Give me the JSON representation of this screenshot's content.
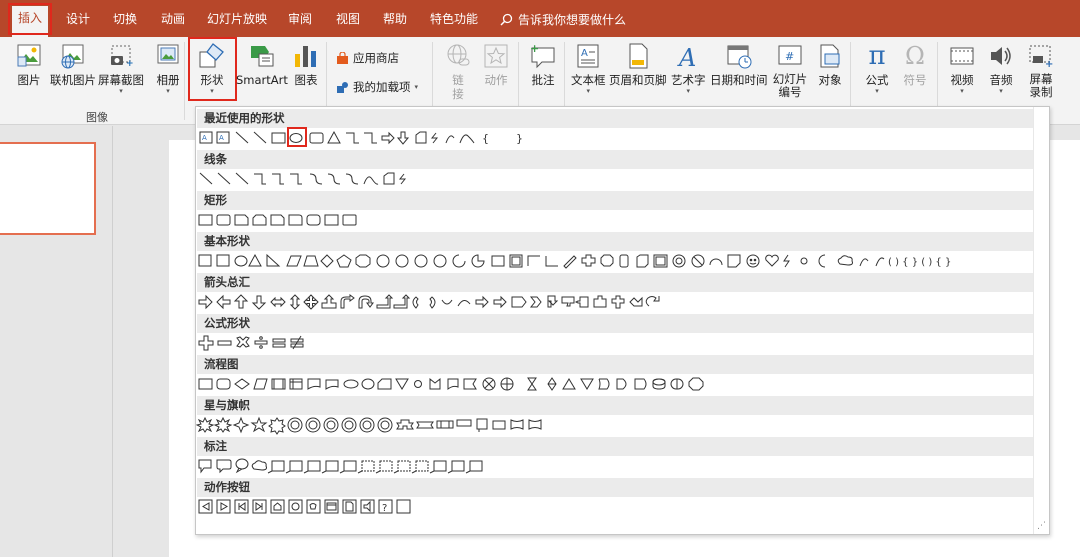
{
  "tabs": [
    {
      "label": "插入",
      "active": true
    },
    {
      "label": "设计"
    },
    {
      "label": "切换"
    },
    {
      "label": "动画"
    },
    {
      "label": "幻灯片放映"
    },
    {
      "label": "审阅"
    },
    {
      "label": "视图"
    },
    {
      "label": "帮助"
    },
    {
      "label": "特色功能"
    }
  ],
  "tell_me": "告诉我你想要做什么",
  "ribbon": {
    "images_group": {
      "label": "图像",
      "buttons": [
        {
          "label": "图片"
        },
        {
          "label": "联机图片"
        },
        {
          "label": "屏幕截图"
        },
        {
          "label": "相册"
        }
      ]
    },
    "shapes": {
      "label": "形状"
    },
    "smartart": {
      "label": "SmartArt"
    },
    "chart": {
      "label": "图表"
    },
    "app_store": {
      "label": "应用商店"
    },
    "my_addins": {
      "label": "我的加载项"
    },
    "link": {
      "label": "链接"
    },
    "action": {
      "label": "动作"
    },
    "comment": {
      "label": "批注"
    },
    "textbox": {
      "label": "文本框"
    },
    "header_footer": {
      "label": "页眉和页脚"
    },
    "wordart": {
      "label": "艺术字"
    },
    "datetime": {
      "label": "日期和时间"
    },
    "slide_number": {
      "label": "幻灯片编号"
    },
    "object": {
      "label": "对象"
    },
    "equation": {
      "label": "公式"
    },
    "symbol": {
      "label": "符号"
    },
    "video": {
      "label": "视频"
    },
    "audio": {
      "label": "音频"
    },
    "screen_record": {
      "label": "屏幕录制"
    }
  },
  "shapes_gallery": {
    "categories": [
      {
        "label": "最近使用的形状"
      },
      {
        "label": "线条"
      },
      {
        "label": "矩形"
      },
      {
        "label": "基本形状"
      },
      {
        "label": "箭头总汇"
      },
      {
        "label": "公式形状"
      },
      {
        "label": "流程图"
      },
      {
        "label": "星与旗帜"
      },
      {
        "label": "标注"
      },
      {
        "label": "动作按钮"
      }
    ]
  },
  "colors": {
    "accent": "#b7472a",
    "highlight": "#e0281c",
    "thumb_border": "#e46e4f"
  }
}
